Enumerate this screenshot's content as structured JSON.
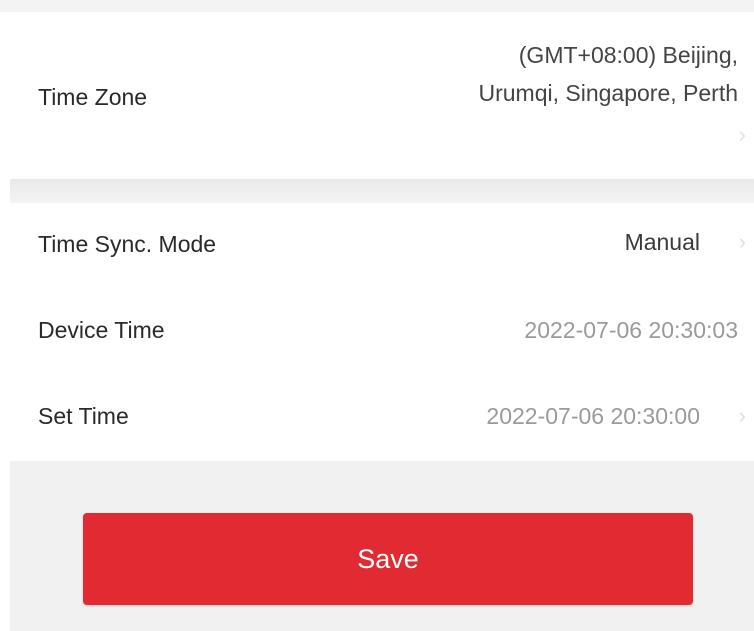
{
  "colors": {
    "primary": "#e12a31",
    "text": "#2a2a2a",
    "muted_text": "#9a9a9a",
    "background": "#f1f1f1"
  },
  "time_zone": {
    "label": "Time Zone",
    "value_line1": "(GMT+08:00) Beijing,",
    "value_line2": "Urumqi, Singapore, Perth",
    "icon": "chevron-right-icon"
  },
  "time_sync_mode": {
    "label": "Time Sync. Mode",
    "value": "Manual",
    "icon": "chevron-right-icon"
  },
  "device_time": {
    "label": "Device Time",
    "value": "2022-07-06 20:30:03"
  },
  "set_time": {
    "label": "Set Time",
    "value": "2022-07-06 20:30:00",
    "icon": "chevron-right-icon"
  },
  "save_button": {
    "label": "Save"
  }
}
